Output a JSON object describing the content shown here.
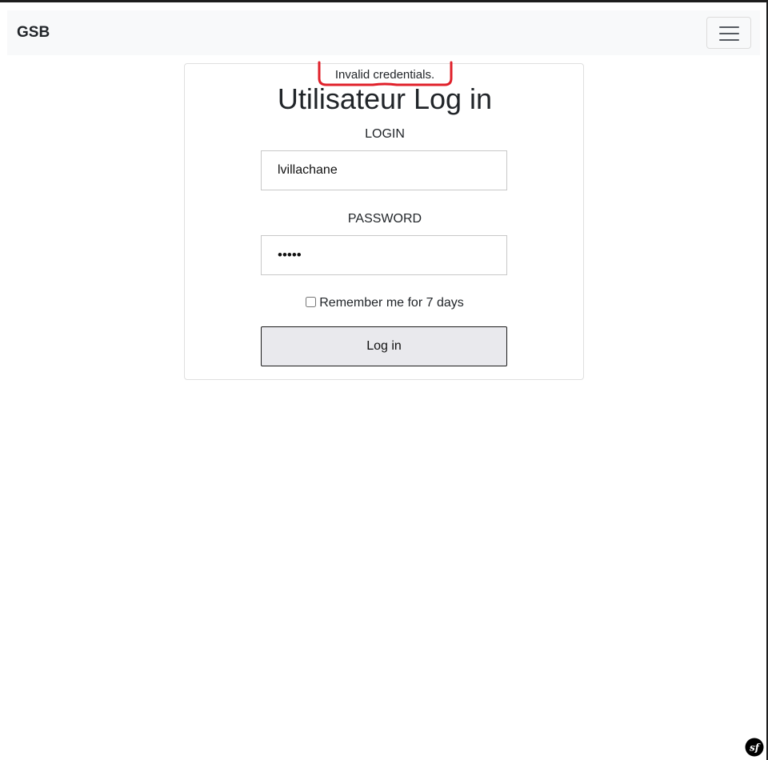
{
  "navbar": {
    "brand": "GSB",
    "toggler_icon": "hamburger-menu-icon"
  },
  "login_card": {
    "error_message": "Invalid credentials.",
    "title": "Utilisateur Log in",
    "login_label": "LOGIN",
    "login_value": "lvillachane",
    "password_label": "PASSWORD",
    "password_value": "•••••",
    "remember_label": "Remember me for 7 days",
    "remember_checked": false,
    "submit_label": "Log in"
  },
  "annotation": {
    "color": "#e0202a"
  },
  "debug_toolbar": {
    "icon": "symfony-logo-icon",
    "glyph": "sf"
  }
}
